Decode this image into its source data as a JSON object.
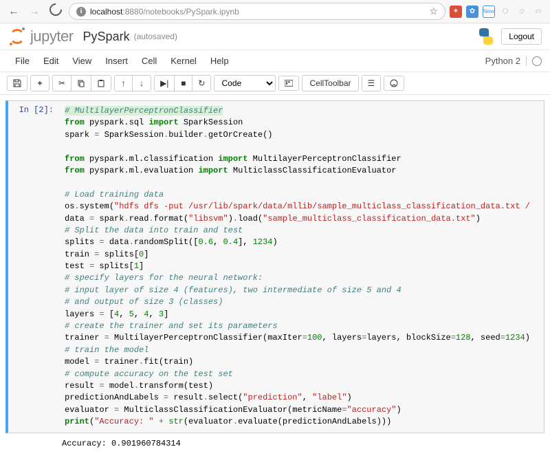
{
  "browser": {
    "url_host": "localhost",
    "url_port": ":8880",
    "url_path": "/notebooks/PySpark.ipynb",
    "ext_new_label": "New"
  },
  "header": {
    "logo_text": "jupyter",
    "notebook_name": "PySpark",
    "autosave": "(autosaved)",
    "logout": "Logout"
  },
  "menu": {
    "file": "File",
    "edit": "Edit",
    "view": "View",
    "insert": "Insert",
    "cell": "Cell",
    "kernel": "Kernel",
    "help": "Help",
    "kernel_name": "Python 2"
  },
  "toolbar": {
    "cell_type": "Code",
    "cell_toolbar": "CellToolbar"
  },
  "cell": {
    "prompt": "In [2]:",
    "code": {
      "l1": "# MultilayerPerceptronClassifier",
      "l2a": "from",
      "l2b": " pyspark.sql ",
      "l2c": "import",
      "l2d": " SparkSession",
      "l3a": "spark ",
      "l3b": "=",
      "l3c": " SparkSession",
      "l3d": ".",
      "l3e": "builder",
      "l3f": ".",
      "l3g": "getOrCreate()",
      "l5a": "from",
      "l5b": " pyspark.ml.classification ",
      "l5c": "import",
      "l5d": " MultilayerPerceptronClassifier",
      "l6a": "from",
      "l6b": " pyspark.ml.evaluation ",
      "l6c": "import",
      "l6d": " MulticlassClassificationEvaluator",
      "l8": "# Load training data",
      "l9a": "os",
      "l9b": ".",
      "l9c": "system(",
      "l9d": "\"hdfs dfs -put /usr/lib/spark/data/mllib/sample_multiclass_classification_data.txt /",
      "l9e": "",
      "l10a": "data ",
      "l10b": "=",
      "l10c": " spark",
      "l10d": ".",
      "l10e": "read",
      "l10f": ".",
      "l10g": "format(",
      "l10h": "\"libsvm\"",
      "l10i": ")",
      "l10j": ".",
      "l10k": "load(",
      "l10l": "\"sample_multiclass_classification_data.txt\"",
      "l10m": ")",
      "l11": "# Split the data into train and test",
      "l12a": "splits ",
      "l12b": "=",
      "l12c": " data",
      "l12d": ".",
      "l12e": "randomSplit([",
      "l12f": "0.6",
      "l12g": ", ",
      "l12h": "0.4",
      "l12i": "], ",
      "l12j": "1234",
      "l12k": ")",
      "l13a": "train ",
      "l13b": "=",
      "l13c": " splits[",
      "l13d": "0",
      "l13e": "]",
      "l14a": "test ",
      "l14b": "=",
      "l14c": " splits[",
      "l14d": "1",
      "l14e": "]",
      "l15": "# specify layers for the neural network:",
      "l16": "# input layer of size 4 (features), two intermediate of size 5 and 4",
      "l17": "# and output of size 3 (classes)",
      "l18a": "layers ",
      "l18b": "=",
      "l18c": " [",
      "l18d": "4",
      "l18e": ", ",
      "l18f": "5",
      "l18g": ", ",
      "l18h": "4",
      "l18i": ", ",
      "l18j": "3",
      "l18k": "]",
      "l19": "# create the trainer and set its parameters",
      "l20a": "trainer ",
      "l20b": "=",
      "l20c": " MultilayerPerceptronClassifier(maxIter",
      "l20d": "=",
      "l20e": "100",
      "l20f": ", layers",
      "l20g": "=",
      "l20h": "layers, blockSize",
      "l20i": "=",
      "l20j": "128",
      "l20k": ", seed",
      "l20l": "=",
      "l20m": "1234",
      "l20n": ")",
      "l21": "# train the model",
      "l22a": "model ",
      "l22b": "=",
      "l22c": " trainer",
      "l22d": ".",
      "l22e": "fit(train)",
      "l23": "# compute accuracy on the test set",
      "l24a": "result ",
      "l24b": "=",
      "l24c": " model",
      "l24d": ".",
      "l24e": "transform(test)",
      "l25a": "predictionAndLabels ",
      "l25b": "=",
      "l25c": " result",
      "l25d": ".",
      "l25e": "select(",
      "l25f": "\"prediction\"",
      "l25g": ", ",
      "l25h": "\"label\"",
      "l25i": ")",
      "l26a": "evaluator ",
      "l26b": "=",
      "l26c": " MulticlassClassificationEvaluator(metricName",
      "l26d": "=",
      "l26e": "\"accuracy\"",
      "l26f": ")",
      "l27a": "print",
      "l27b": "(",
      "l27c": "\"Accuracy: \"",
      "l27d": " ",
      "l27e": "+",
      "l27f": " ",
      "l27g": "str",
      "l27h": "(evaluator",
      "l27i": ".",
      "l27j": "evaluate(predictionAndLabels)))"
    },
    "output": "Accuracy: 0.901960784314"
  }
}
